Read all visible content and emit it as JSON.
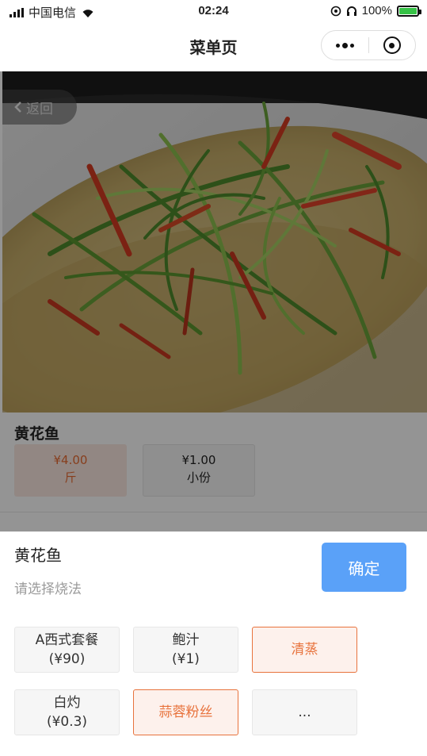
{
  "status": {
    "carrier": "中国电信",
    "time": "02:24",
    "battery": "100%"
  },
  "navbar": {
    "title": "菜单页"
  },
  "hero": {
    "back_label": "返回"
  },
  "dish": {
    "name": "黄花鱼",
    "prices": [
      {
        "price": "¥4.00",
        "unit": "斤",
        "selected": true
      },
      {
        "price": "¥1.00",
        "unit": "小份",
        "selected": false
      }
    ]
  },
  "sheet": {
    "title": "黄花鱼",
    "subtitle": "请选择烧法",
    "confirm_label": "确定",
    "options": [
      {
        "name": "A西式套餐",
        "price": "(¥90)",
        "selected": false
      },
      {
        "name": "鲍汁",
        "price": "(¥1)",
        "selected": false
      },
      {
        "name": "清蒸",
        "price": "",
        "selected": true
      },
      {
        "name": "白灼",
        "price": "(¥0.3)",
        "selected": false
      },
      {
        "name": "蒜蓉粉丝",
        "price": "",
        "selected": true
      },
      {
        "name": "...",
        "price": "",
        "selected": false
      }
    ]
  },
  "colors": {
    "accent": "#e8733d",
    "confirm": "#5aa1f8",
    "price_selected_bg": "#fbe9e2"
  }
}
